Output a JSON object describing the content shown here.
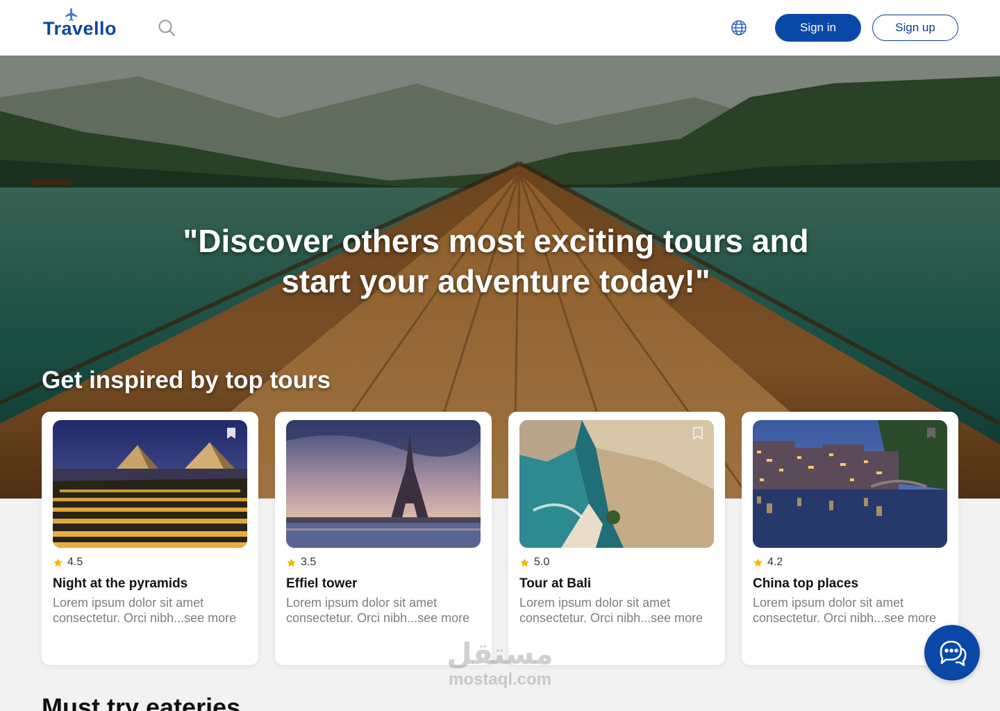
{
  "header": {
    "logo_text": "Travello",
    "signin_label": "Sign in",
    "signup_label": "Sign up",
    "icons": [
      "airplane-icon",
      "search-icon",
      "globe-icon"
    ]
  },
  "hero": {
    "quote_line1": "\"Discover others most exciting tours and",
    "quote_line2": "start your adventure today!\""
  },
  "top_tours": {
    "title": "Get inspired by top tours",
    "cards": [
      {
        "rating": "4.5",
        "title": "Night at the pyramids",
        "description": "Lorem ipsum dolor sit amet consectetur. Orci nibh...see more"
      },
      {
        "rating": "3.5",
        "title": "Effiel tower",
        "description": "Lorem ipsum dolor sit amet consectetur. Orci nibh...see more"
      },
      {
        "rating": "5.0",
        "title": "Tour at Bali",
        "description": "Lorem ipsum dolor sit amet consectetur. Orci nibh...see more"
      },
      {
        "rating": "4.2",
        "title": "China top places",
        "description": "Lorem ipsum dolor sit amet consectetur. Orci nibh...see more"
      }
    ]
  },
  "next_section": {
    "title": "Must try  eateries"
  },
  "watermark": {
    "arabic": "مستقل",
    "latin": "mostaql.com"
  },
  "colors": {
    "brand": "#0a48a8",
    "star": "#f5b800",
    "page_bg": "#f2f2f2"
  }
}
